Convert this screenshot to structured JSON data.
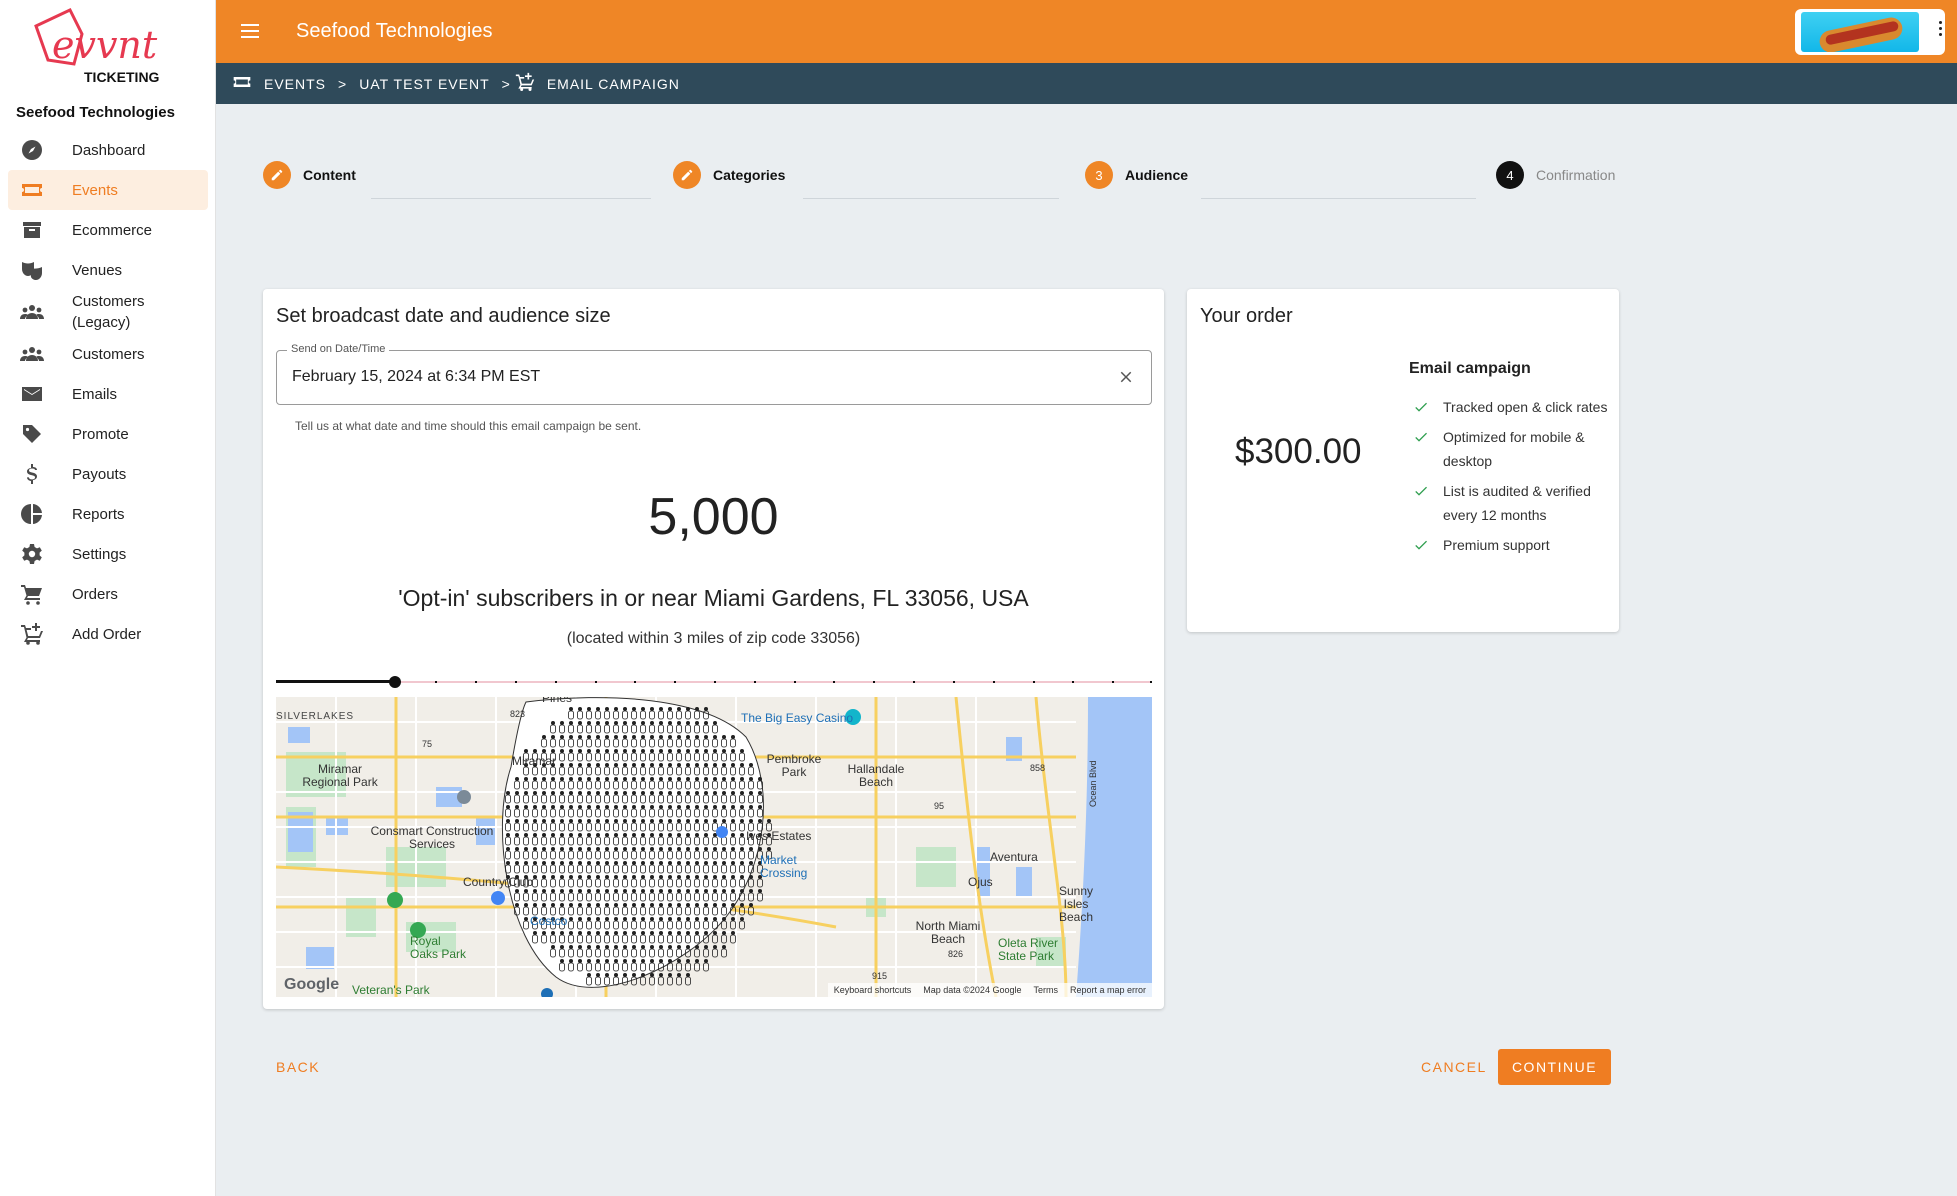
{
  "brand": {
    "logo_text": "evvnt",
    "logo_sub": "TICKETING",
    "accent": "#ef8626",
    "sidebar_active_bg": "#fdeee0",
    "topbar_dark": "#2f4a5a"
  },
  "sidebar": {
    "org_name": "Seefood Technologies",
    "items": [
      {
        "label": "Dashboard",
        "icon": "compass-icon"
      },
      {
        "label": "Events",
        "icon": "ticket-icon",
        "active": true
      },
      {
        "label": "Ecommerce",
        "icon": "archive-icon"
      },
      {
        "label": "Venues",
        "icon": "theater-masks-icon"
      },
      {
        "label": "Customers (Legacy)",
        "icon": "people-icon"
      },
      {
        "label": "Customers",
        "icon": "people-icon"
      },
      {
        "label": "Emails",
        "icon": "mail-icon"
      },
      {
        "label": "Promote",
        "icon": "tag-icon"
      },
      {
        "label": "Payouts",
        "icon": "dollar-icon"
      },
      {
        "label": "Reports",
        "icon": "pie-chart-icon"
      },
      {
        "label": "Settings",
        "icon": "gear-icon"
      },
      {
        "label": "Orders",
        "icon": "cart-icon"
      },
      {
        "label": "Add Order",
        "icon": "cart-plus-icon"
      }
    ]
  },
  "topbar": {
    "company": "Seefood Technologies",
    "avatar_alt": "hot-dog-avatar"
  },
  "breadcrumb": {
    "items": [
      "EVENTS",
      "UAT TEST EVENT",
      "EMAIL CAMPAIGN"
    ],
    "separator": ">"
  },
  "stepper": {
    "steps": [
      {
        "label": "Content",
        "state": "done"
      },
      {
        "label": "Categories",
        "state": "done"
      },
      {
        "label": "Audience",
        "state": "active",
        "number": "3"
      },
      {
        "label": "Confirmation",
        "state": "pending",
        "number": "4"
      }
    ]
  },
  "broadcast": {
    "title": "Set broadcast date and audience size",
    "date_label": "Send on Date/Time",
    "date_value": "February 15, 2024 at 6:34 PM EST",
    "helper": "Tell us at what date and time should this email campaign be sent.",
    "count": "5,000",
    "subscribers_text": "'Opt-in' subscribers in or near Miami Gardens, FL 33056, USA",
    "radius_note": "(located within 3 miles of zip code 33056)",
    "slider": {
      "value_fraction": 0.136,
      "steps": 22
    }
  },
  "map": {
    "labels": {
      "silverlakes": "SILVERLAKES",
      "pines": "Pines",
      "miramar": "Miramar",
      "miramar_park": "Miramar Regional Park",
      "big_easy": "The Big Easy Casino",
      "pembroke_park": "Pembroke Park",
      "hallandale": "Hallandale Beach",
      "ives_estates": "Ives Estates",
      "consmart": "Consmart Construction Services",
      "aventura": "Aventura",
      "market_crossing": "Market Crossing",
      "country_club": "Country Club",
      "ojus": "Ojus",
      "sunny_isles": "Sunny Isles Beach",
      "costco": "Costco",
      "royal_oaks": "Royal Oaks Park",
      "nmb": "North Miami Beach",
      "oleta": "Oleta River State Park",
      "veterans": "Veteran's Park",
      "ocean_blvd": "Ocean Blvd",
      "r823": "823",
      "r75": "75",
      "r95": "95",
      "r858": "858",
      "r826": "826",
      "r915": "915"
    },
    "footer": [
      "Keyboard shortcuts",
      "Map data ©2024 Google",
      "Terms",
      "Report a map error"
    ],
    "google": "Google"
  },
  "order": {
    "title": "Your order",
    "price": "$300.00",
    "package": "Email campaign",
    "features": [
      "Tracked open & click rates",
      "Optimized for mobile & desktop",
      "List is audited & verified every 12 months",
      "Premium support"
    ]
  },
  "actions": {
    "back": "BACK",
    "cancel": "CANCEL",
    "continue": "CONTINUE"
  }
}
